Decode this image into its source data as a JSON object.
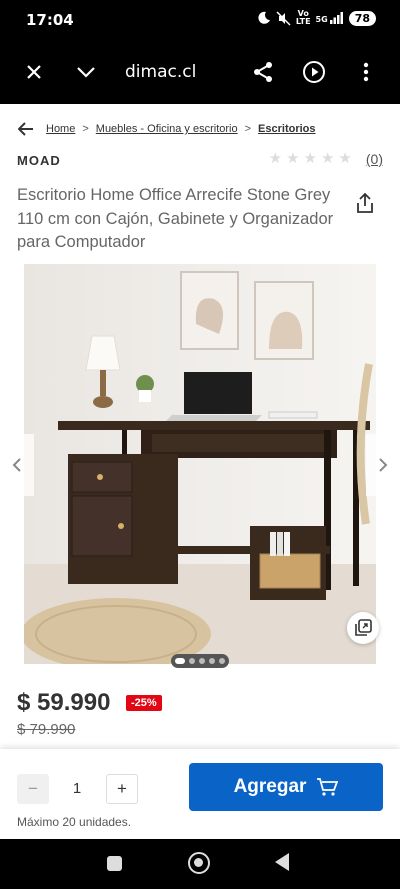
{
  "status_bar": {
    "time": "17:04",
    "network_top": "Vo",
    "network_bottom": "LTE",
    "signal_label": "5G",
    "battery": "78"
  },
  "browser": {
    "url": "dimac.cl"
  },
  "breadcrumb": {
    "items": [
      "Home",
      "Muebles - Oficina y escritorio",
      "Escritorios"
    ],
    "separator": ">"
  },
  "product": {
    "brand": "MOAD",
    "rating_count": "(0)",
    "stars": 5,
    "title": "Escritorio Home Office Arrecife Stone Grey 110 cm con Cajón, Gabinete y Organizador para Computador",
    "price": "$ 59.990",
    "discount": "-25%",
    "old_price": "$ 79.990"
  },
  "gallery": {
    "slide_count": 5,
    "active_slide": 1
  },
  "cart": {
    "minus_label": "−",
    "quantity": "1",
    "plus_label": "+",
    "add_label": "Agregar",
    "max_text": "Máximo 20 unidades."
  },
  "colors": {
    "accent": "#0a64c8",
    "discount": "#e30613"
  }
}
